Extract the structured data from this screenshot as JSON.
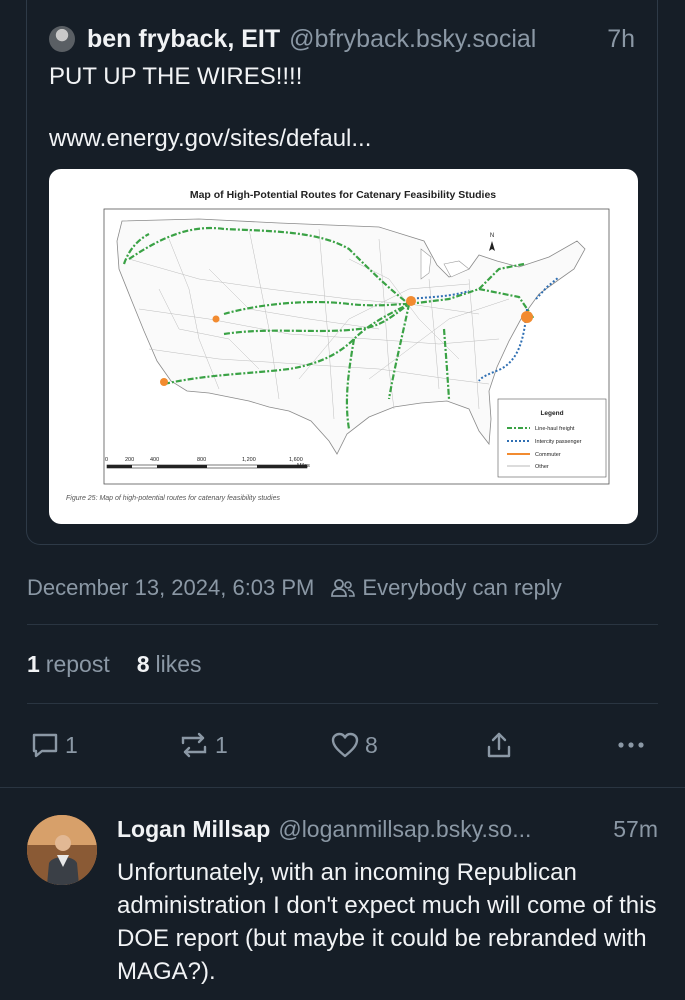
{
  "quoted_post": {
    "author_name": "ben fryback, EIT",
    "author_handle": "@bfryback.bsky.social",
    "time": "7h",
    "text": "PUT UP THE WIRES!!!!",
    "link": "www.energy.gov/sites/defaul...",
    "embed": {
      "title": "Map of High-Potential Routes for Catenary Feasibility Studies",
      "caption": "Figure 25: Map of high-potential routes for catenary feasibility studies",
      "north_label": "N",
      "scale": {
        "ticks": [
          "0",
          "200",
          "400",
          "800",
          "1,200",
          "1,600"
        ],
        "unit": "Miles"
      },
      "legend": {
        "title": "Legend",
        "items": [
          {
            "label": "Line-haul freight",
            "color": "#3aa245",
            "style": "dash-dot"
          },
          {
            "label": "Intercity passenger",
            "color": "#2f6fb3",
            "style": "dotted"
          },
          {
            "label": "Commuter",
            "color": "#f28b30",
            "style": "solid"
          },
          {
            "label": "Other",
            "color": "#c8c8c8",
            "style": "solid"
          }
        ]
      }
    }
  },
  "post_meta": {
    "timestamp": "December 13, 2024, 6:03 PM",
    "reply_setting": "Everybody can reply",
    "people_icon": "people-icon"
  },
  "stats": {
    "reposts_count": "1",
    "reposts_label": "repost",
    "likes_count": "8",
    "likes_label": "likes"
  },
  "actions": {
    "reply_count": "1",
    "repost_count": "1",
    "like_count": "8",
    "icons": [
      "reply-icon",
      "repost-icon",
      "heart-icon",
      "share-icon",
      "more-icon"
    ]
  },
  "reply": {
    "author_name": "Logan Millsap",
    "author_handle": "@loganmillsap.bsky.so...",
    "time": "57m",
    "text": "Unfortunately, with an incoming Republican administration I don't expect much will come of this DOE report (but maybe it could be rebranded with MAGA?)."
  },
  "colors": {
    "background": "#161e27",
    "text": "#f1f3f5",
    "muted": "#8b98a5",
    "border": "#2e3a47"
  }
}
